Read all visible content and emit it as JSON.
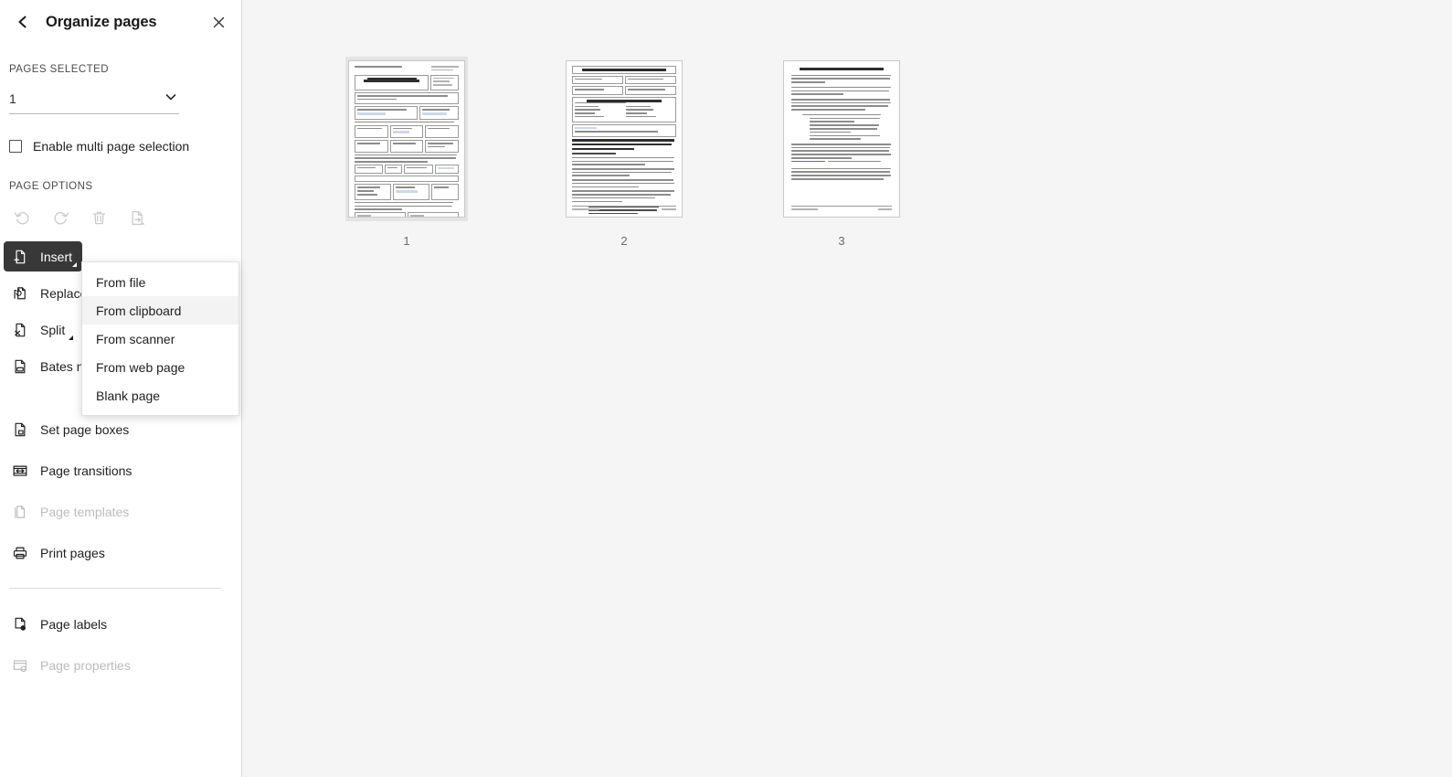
{
  "panel": {
    "title": "Organize pages",
    "back_icon": "chevron-left-icon",
    "close_icon": "close-icon"
  },
  "pages_selected": {
    "label": "PAGES SELECTED",
    "value": "1",
    "caret_icon": "chevron-down-icon"
  },
  "multi_select": {
    "label": "Enable multi page selection",
    "checked": false
  },
  "page_options": {
    "label": "PAGE OPTIONS",
    "quick_actions": [
      {
        "name": "rotate-left-icon",
        "label": "Rotate counterclockwise",
        "disabled": true
      },
      {
        "name": "rotate-right-icon",
        "label": "Rotate clockwise",
        "disabled": true
      },
      {
        "name": "delete-icon",
        "label": "Delete pages",
        "disabled": true
      },
      {
        "name": "extract-icon",
        "label": "Extract pages",
        "disabled": true
      }
    ],
    "tools": [
      {
        "label": "Insert",
        "icon": "insert-page-icon",
        "has_caret": true,
        "active": true,
        "disabled": false
      },
      {
        "label": "Replace",
        "icon": "replace-page-icon",
        "has_caret": false,
        "active": false,
        "disabled": false
      },
      {
        "label": "Split",
        "icon": "split-page-icon",
        "has_caret": true,
        "active": false,
        "disabled": false
      },
      {
        "label": "Bates numbering",
        "icon": "bates-numbering-icon",
        "has_caret": false,
        "active": false,
        "disabled": false
      }
    ],
    "secondary_tools": [
      {
        "label": "Set page boxes",
        "icon": "page-boxes-icon",
        "disabled": false
      },
      {
        "label": "Page transitions",
        "icon": "page-transitions-icon",
        "disabled": false
      },
      {
        "label": "Page templates",
        "icon": "page-templates-icon",
        "disabled": true
      },
      {
        "label": "Print pages",
        "icon": "printer-icon",
        "disabled": false
      }
    ],
    "tertiary_tools": [
      {
        "label": "Page labels",
        "icon": "page-labels-icon",
        "disabled": false
      },
      {
        "label": "Page properties",
        "icon": "page-properties-icon",
        "disabled": true
      }
    ]
  },
  "insert_menu": {
    "items": [
      {
        "label": "From file",
        "hovered": false
      },
      {
        "label": "From clipboard",
        "hovered": true
      },
      {
        "label": "From scanner",
        "hovered": false
      },
      {
        "label": "From web page",
        "hovered": false
      },
      {
        "label": "Blank page",
        "hovered": false
      }
    ]
  },
  "thumbnails": [
    {
      "caption": "1",
      "selected": true
    },
    {
      "caption": "2",
      "selected": false
    },
    {
      "caption": "3",
      "selected": false
    }
  ],
  "colors": {
    "accent_dark": "#383838",
    "sidebar_bg": "#ffffff",
    "canvas_bg": "#f5f5f5",
    "selection_bg": "#e4e4e4",
    "menu_hover": "#f3f3f3",
    "disabled_text": "#bcbcbc"
  }
}
